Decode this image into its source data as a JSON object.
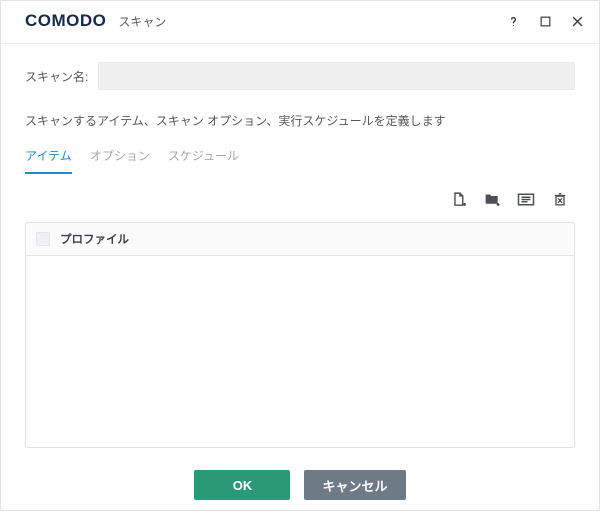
{
  "header": {
    "logo": "COMODO",
    "title": "スキャン"
  },
  "form": {
    "name_label": "スキャン名:",
    "name_value": "",
    "subtitle": "スキャンするアイテム、スキャン オプション、実行スケジュールを定義します"
  },
  "tabs": {
    "items": [
      "アイテム",
      "オプション",
      "スケジュール"
    ],
    "active_index": 0
  },
  "toolbar": {
    "btn_add_file": "add-file",
    "btn_add_folder": "add-folder",
    "btn_add_area": "add-area",
    "btn_delete": "delete"
  },
  "list": {
    "header_label": "プロファイル"
  },
  "footer": {
    "ok_label": "OK",
    "cancel_label": "キャンセル"
  }
}
